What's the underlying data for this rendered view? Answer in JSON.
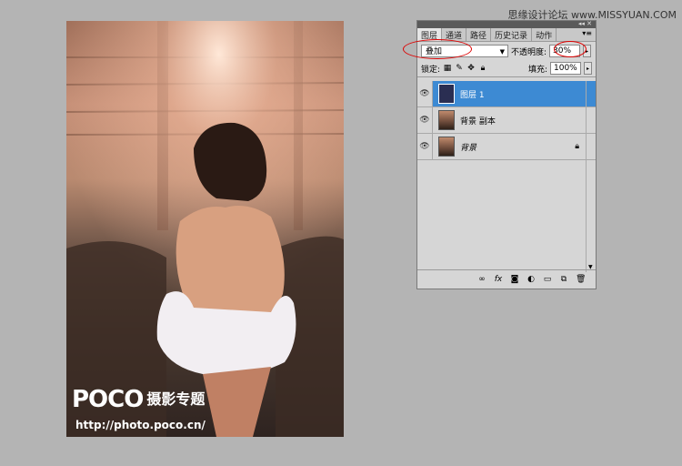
{
  "watermark": "思缘设计论坛 www.MISSYUAN.COM",
  "photo": {
    "brand": "POCO",
    "brand_sub": "摄影专题",
    "url": "http://photo.poco.cn/"
  },
  "panel": {
    "tabs": [
      "图层",
      "通道",
      "路径",
      "历史记录",
      "动作"
    ],
    "blend_mode": "叠加",
    "opacity_label": "不透明度:",
    "opacity_value": "30%",
    "lock_label": "锁定:",
    "fill_label": "填充:",
    "fill_value": "100%",
    "layers": [
      {
        "name": "图层 1",
        "selected": true
      },
      {
        "name": "背景 副本",
        "selected": false
      },
      {
        "name": "背景",
        "selected": false,
        "locked": true
      }
    ],
    "bottom_icons": [
      "link-icon",
      "fx-icon",
      "mask-icon",
      "adjustment-icon",
      "group-icon",
      "new-layer-icon",
      "trash-icon"
    ]
  },
  "colors": {
    "selection": "#3d8ad3",
    "annotation": "#dd0000"
  }
}
